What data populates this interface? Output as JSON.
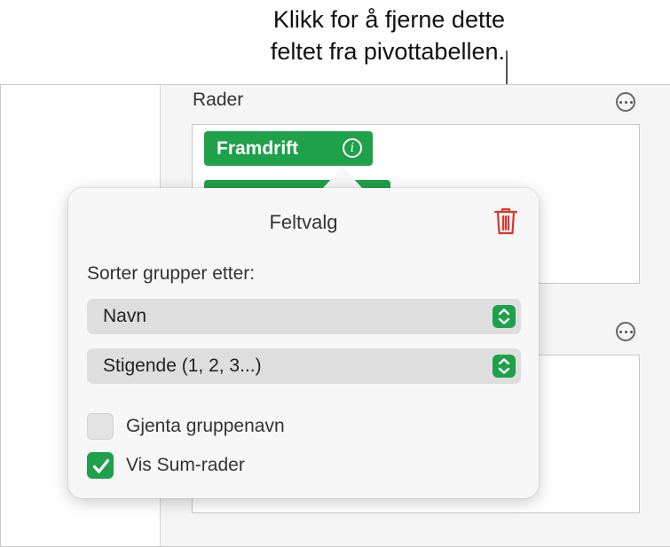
{
  "callout": {
    "line1": "Klikk for å fjerne dette",
    "line2": "feltet fra pivottabellen."
  },
  "sidebar": {
    "rows_label": "Rader",
    "field_pill": "Framdrift"
  },
  "popover": {
    "title": "Feltvalg",
    "sort_label": "Sorter grupper etter:",
    "sort_by_value": "Navn",
    "sort_order_value": "Stigende (1, 2, 3...)",
    "repeat_group_names_label": "Gjenta gruppenavn",
    "repeat_group_names_checked": false,
    "show_sum_rows_label": "Vis Sum-rader",
    "show_sum_rows_checked": true
  },
  "colors": {
    "accent_green": "#1fa04a",
    "delete_red": "#e0352b"
  },
  "icons": [
    "info-icon",
    "trash-icon",
    "more-icon",
    "stepper-icon",
    "checkmark-icon"
  ]
}
